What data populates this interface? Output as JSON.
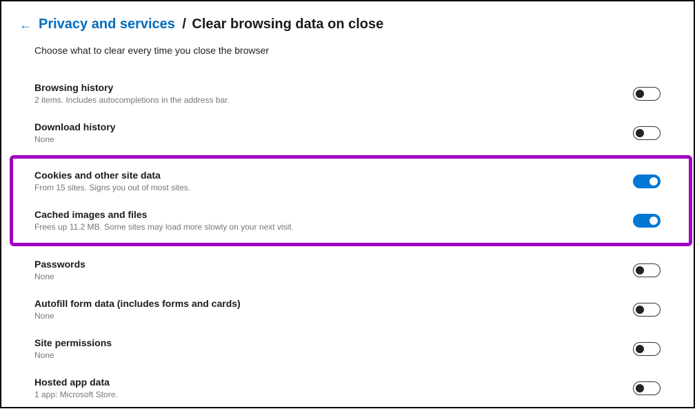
{
  "header": {
    "breadcrumb_link": "Privacy and services",
    "separator": "/",
    "current": "Clear browsing data on close"
  },
  "subheading": "Choose what to clear every time you close the browser",
  "items": {
    "browsing_history": {
      "title": "Browsing history",
      "desc": "2 items. Includes autocompletions in the address bar.",
      "on": false
    },
    "download_history": {
      "title": "Download history",
      "desc": "None",
      "on": false
    },
    "cookies": {
      "title": "Cookies and other site data",
      "desc": "From 15 sites. Signs you out of most sites.",
      "on": true
    },
    "cache": {
      "title": "Cached images and files",
      "desc": "Frees up 11.2 MB. Some sites may load more slowly on your next visit.",
      "on": true
    },
    "passwords": {
      "title": "Passwords",
      "desc": "None",
      "on": false
    },
    "autofill": {
      "title": "Autofill form data (includes forms and cards)",
      "desc": "None",
      "on": false
    },
    "site_permissions": {
      "title": "Site permissions",
      "desc": "None",
      "on": false
    },
    "hosted_app": {
      "title": "Hosted app data",
      "desc": "1 app: Microsoft Store.",
      "on": false
    }
  }
}
